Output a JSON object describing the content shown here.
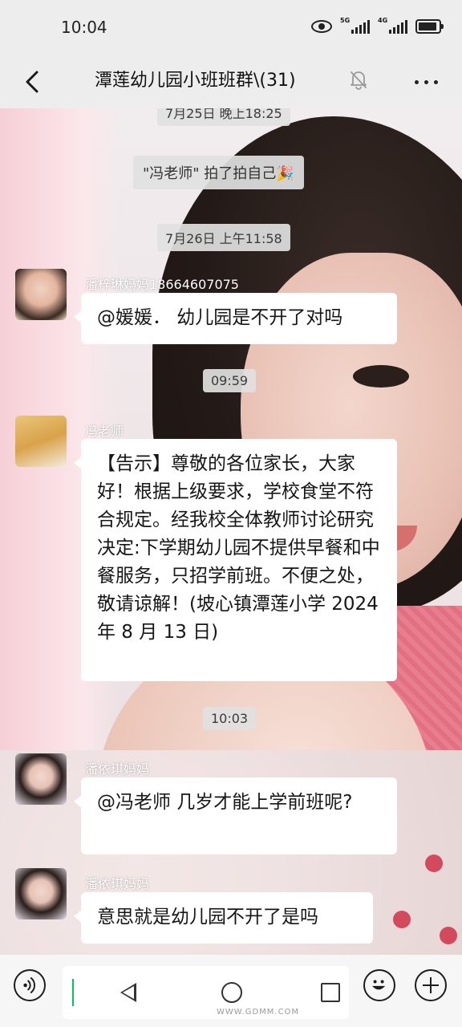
{
  "status_bar": {
    "time": "10:04",
    "net1": "5G",
    "net2": "4G"
  },
  "header": {
    "title": "潭莲幼儿园小班班群\\(31)"
  },
  "chat": {
    "partial_timestamp": "7月25日 晚上18:25",
    "system_message": "\"冯老师\" 拍了拍自己🎉",
    "messages": [
      {
        "timestamp": "7月26日 上午11:58",
        "sender": "潘梓琳妈妈18664607075",
        "text": "@媛媛． 幼儿园是不开了对吗"
      },
      {
        "timestamp": "09:59",
        "sender": "冯老师",
        "text": "【告示】尊敬的各位家长，大家好！根据上级要求，学校食堂不符合规定。经我校全体教师讨论研究决定:下学期幼儿园不提供早餐和中餐服务，只招学前班。不便之处，敬请谅解！(坡心镇潭莲小学 2024 年 8 月 13 日)"
      },
      {
        "timestamp": "10:03",
        "sender": "潘依琪妈妈",
        "text": "@冯老师 几岁才能上学前班呢?"
      },
      {
        "sender": "潘依琪妈妈",
        "text": "意思就是幼儿园不开了是吗"
      }
    ]
  },
  "input_bar": {
    "text": ""
  },
  "watermark": "WWW.GDMM.COM",
  "colors": {
    "bubble": "#ffffff",
    "bar": "#ededed",
    "cursor": "#07c160"
  }
}
